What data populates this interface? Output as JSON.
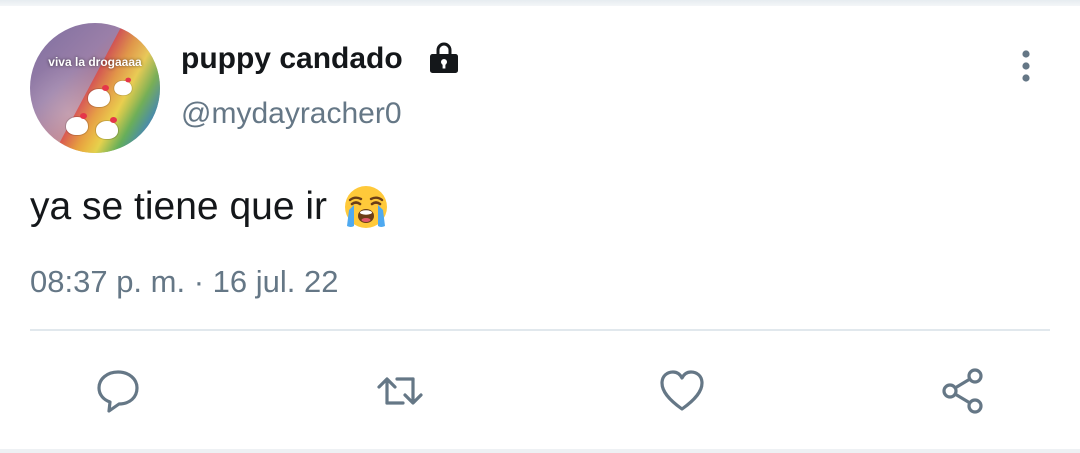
{
  "tweet": {
    "author": {
      "display_name": "puppy candado",
      "handle": "@mydayracher0",
      "avatar_caption": "viva la drogaaaa",
      "protected": true
    },
    "text": "ya se tiene que ir",
    "emoji": "loudly-crying-face",
    "timestamp": "08:37 p. m. · 16 jul. 22"
  },
  "actions": {
    "icons": [
      "reply-icon",
      "retweet-icon",
      "like-icon",
      "share-icon"
    ]
  },
  "colors": {
    "text_primary": "#14171a",
    "text_secondary": "#657786",
    "icon": "#657786",
    "divider": "#e1e8ed",
    "background": "#ffffff"
  }
}
